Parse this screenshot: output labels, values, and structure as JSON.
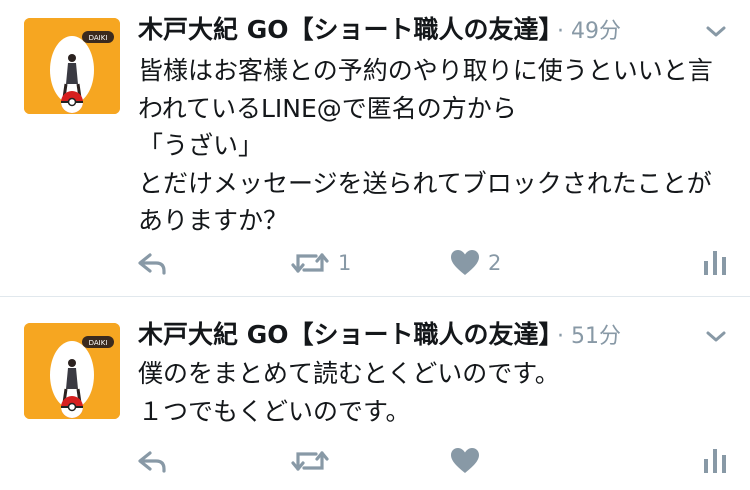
{
  "colors": {
    "accent": "#f6a621",
    "icon": "#8899a6",
    "text": "#14171a",
    "meta": "#8899a6"
  },
  "tweets": [
    {
      "author": "木戸大紀 GO【ショート職人の友達】",
      "time": "· 49分",
      "avatar_label": "DAIKI",
      "text": "皆様はお客様との予約のやり取りに使うといいと言われているLINE@で匿名の方から\n「うざい」\nとだけメッセージを送られてブロックされたことがありますか？",
      "retweet_count": "1",
      "like_count": "2",
      "icons": [
        "reply-icon",
        "retweet-icon",
        "like-icon",
        "analytics-icon",
        "chevron-down-icon"
      ]
    },
    {
      "author": "木戸大紀 GO【ショート職人の友達】",
      "time": "· 51分",
      "avatar_label": "DAIKI",
      "text": "僕のをまとめて読むとくどいのです。\n１つでもくどいのです。",
      "retweet_count": "",
      "like_count": "",
      "icons": [
        "reply-icon",
        "retweet-icon",
        "like-icon",
        "analytics-icon",
        "chevron-down-icon"
      ]
    }
  ]
}
